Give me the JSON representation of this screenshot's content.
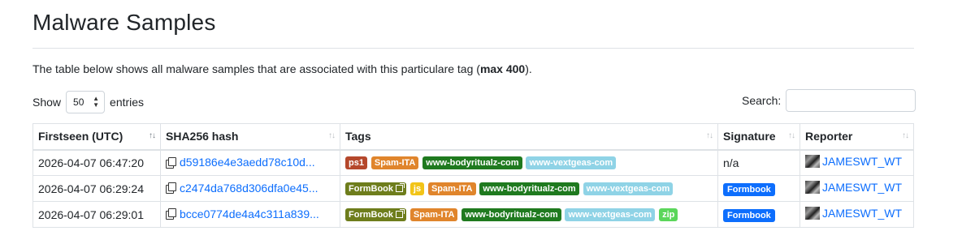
{
  "page": {
    "title": "Malware Samples",
    "intro_prefix": "The table below shows all malware samples that are associated with this particulare tag (",
    "intro_bold": "max 400",
    "intro_suffix": ")."
  },
  "controls": {
    "show_label": "Show",
    "entries_value": "50",
    "entries_label": "entries",
    "search_label": "Search:",
    "search_value": ""
  },
  "table": {
    "columns": [
      "Firstseen (UTC)",
      "SHA256 hash",
      "Tags",
      "Signature",
      "Reporter"
    ],
    "rows": [
      {
        "firstseen": "2026-04-07 06:47:20",
        "hash": "d59186e4e3aedd78c10d...",
        "tags": [
          {
            "label": "ps1",
            "color": "#b5482c",
            "ext": false
          },
          {
            "label": "Spam-ITA",
            "color": "#e0852c",
            "ext": false
          },
          {
            "label": "www-bodyritualz-com",
            "color": "#1f7a1f",
            "ext": false
          },
          {
            "label": "www-vextgeas-com",
            "color": "#8fd3e6",
            "ext": false
          }
        ],
        "signature": "n/a",
        "signature_badge": false,
        "reporter": "JAMESWT_WT"
      },
      {
        "firstseen": "2026-04-07 06:29:24",
        "hash": "c2474da768d306dfa0e45...",
        "tags": [
          {
            "label": "FormBook",
            "color": "#6e7d1c",
            "ext": true
          },
          {
            "label": "js",
            "color": "#f2c418",
            "ext": false
          },
          {
            "label": "Spam-ITA",
            "color": "#e0852c",
            "ext": false
          },
          {
            "label": "www-bodyritualz-com",
            "color": "#1f7a1f",
            "ext": false
          },
          {
            "label": "www-vextgeas-com",
            "color": "#8fd3e6",
            "ext": false
          }
        ],
        "signature": "Formbook",
        "signature_badge": true,
        "reporter": "JAMESWT_WT"
      },
      {
        "firstseen": "2026-04-07 06:29:01",
        "hash": "bcce0774de4a4c311a839...",
        "tags": [
          {
            "label": "FormBook",
            "color": "#6e7d1c",
            "ext": true
          },
          {
            "label": "Spam-ITA",
            "color": "#e0852c",
            "ext": false
          },
          {
            "label": "www-bodyritualz-com",
            "color": "#1f7a1f",
            "ext": false
          },
          {
            "label": "www-vextgeas-com",
            "color": "#8fd3e6",
            "ext": false
          },
          {
            "label": "zip",
            "color": "#5bd65b",
            "ext": false
          }
        ],
        "signature": "Formbook",
        "signature_badge": true,
        "reporter": "JAMESWT_WT"
      }
    ]
  },
  "icons": {
    "copy": "copy-icon",
    "external_link": "external-link-icon",
    "sort": "sort-icon",
    "caret": "chevron-updown-icon",
    "avatar": "reporter-avatar"
  },
  "colors": {
    "link": "#0d6efd",
    "border": "#dee2e6",
    "signature_badge": "#0d6efd"
  }
}
